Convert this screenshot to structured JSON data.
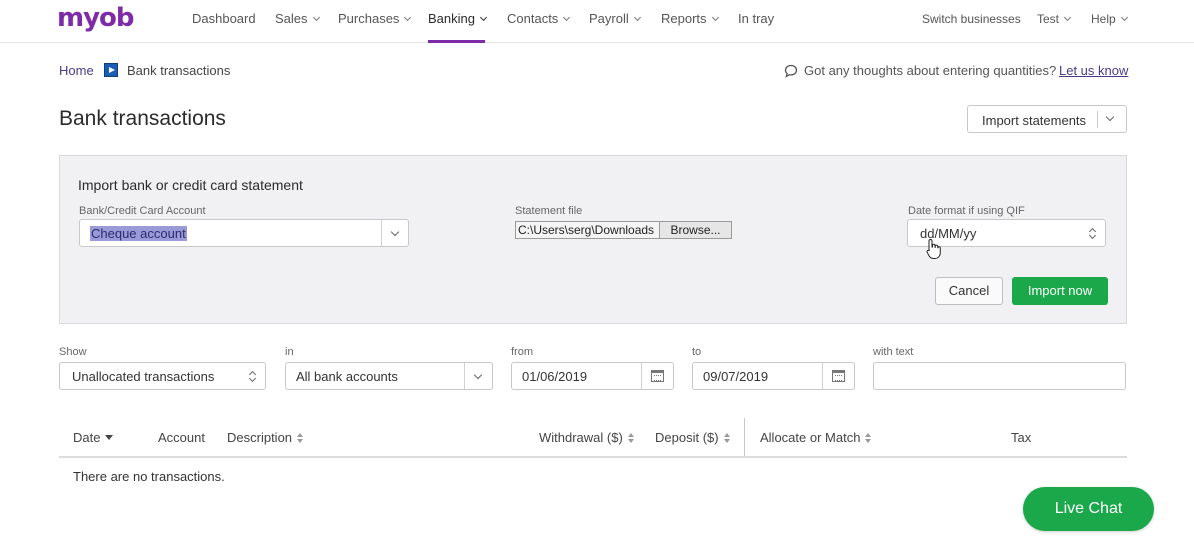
{
  "brand": {
    "logo": "myob",
    "accent": "#7f2ba8",
    "primary_green": "#1aa84b"
  },
  "nav": {
    "items": [
      {
        "label": "Dashboard",
        "dropdown": false
      },
      {
        "label": "Sales",
        "dropdown": true
      },
      {
        "label": "Purchases",
        "dropdown": true
      },
      {
        "label": "Banking",
        "dropdown": true,
        "active": true
      },
      {
        "label": "Contacts",
        "dropdown": true
      },
      {
        "label": "Payroll",
        "dropdown": true
      },
      {
        "label": "Reports",
        "dropdown": true
      },
      {
        "label": "In tray",
        "dropdown": false
      }
    ],
    "right": [
      {
        "label": "Switch businesses",
        "dropdown": false
      },
      {
        "label": "Test",
        "dropdown": true
      },
      {
        "label": "Help",
        "dropdown": true
      }
    ]
  },
  "breadcrumb": {
    "home": "Home",
    "current": "Bank transactions"
  },
  "feedback": {
    "text": "Got any thoughts about entering quantities?",
    "link": "Let us know"
  },
  "page_title": "Bank transactions",
  "import_statements_button": "Import statements",
  "import_panel": {
    "title": "Import bank or credit card statement",
    "account_label": "Bank/Credit Card Account",
    "account_value": "Cheque account",
    "file_label": "Statement file",
    "file_path": "C:\\Users\\serg\\Downloads",
    "browse_label": "Browse...",
    "date_format_label": "Date format if using QIF",
    "date_format_value": "dd/MM/yy",
    "cancel_label": "Cancel",
    "import_label": "Import now"
  },
  "filters": {
    "show_label": "Show",
    "show_value": "Unallocated transactions",
    "in_label": "in",
    "in_value": "All bank accounts",
    "from_label": "from",
    "from_value": "01/06/2019",
    "to_label": "to",
    "to_value": "09/07/2019",
    "text_label": "with text",
    "text_value": ""
  },
  "table": {
    "columns": [
      "Date",
      "Account",
      "Description",
      "Withdrawal ($)",
      "Deposit ($)",
      "Allocate or Match",
      "Tax"
    ],
    "empty_message": "There are no transactions."
  },
  "live_chat": "Live Chat"
}
